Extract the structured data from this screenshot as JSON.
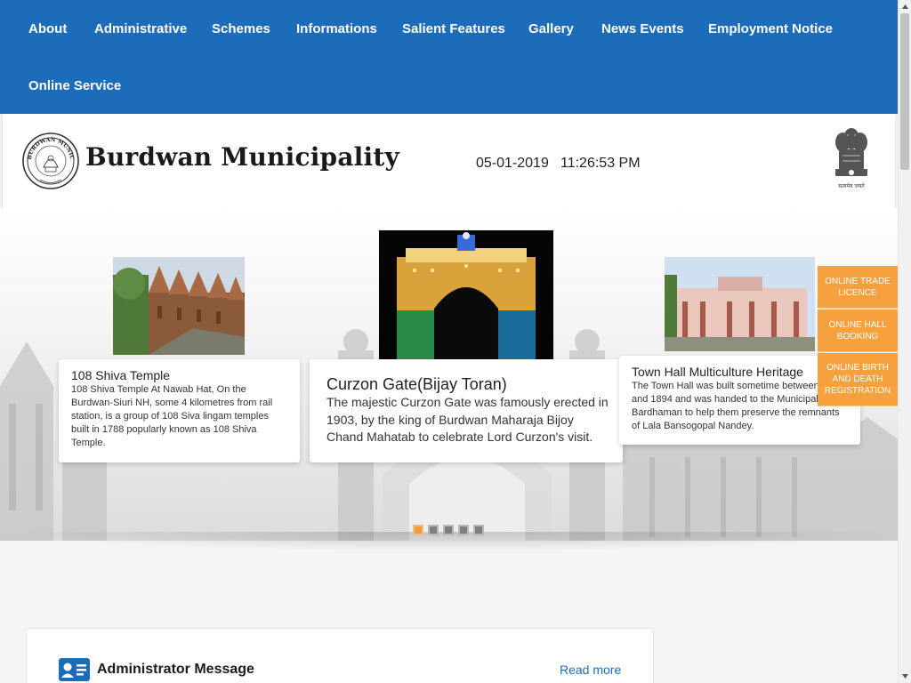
{
  "nav": {
    "items": [
      "About",
      "Administrative",
      "Schemes",
      "Informations",
      "Salient Features",
      "Gallery",
      "News Events",
      "Employment Notice",
      "Online Service"
    ]
  },
  "header": {
    "title": "Burdwan Municipality",
    "date": "05-01-2019",
    "time": "11:26:53 PM",
    "seal_text": "BURDWAN MUNICIPALITY",
    "emblem_text": "सत्यमेव जयते"
  },
  "carousel": {
    "slides": [
      {
        "title": "108 Shiva Temple",
        "text": "108 Shiva Temple At Nawab Hat, On the Burdwan-Siuri NH, some 4 kilometres from rail station, is a group of 108 Siva lingam temples built in 1788 popularly known as 108 Shiva Temple."
      },
      {
        "title": "Curzon Gate(Bijay Toran)",
        "text": "The majestic Curzon Gate was famously erected in 1903, by the king of Burdwan Maharaja Bijoy Chand Mahatab to celebrate Lord Curzon's visit."
      },
      {
        "title": "Town Hall Multiculture Heritage",
        "text": "The Town Hall was built sometime between 1890 and 1894 and was handed to the Municipality of Bardhaman to help them preserve the remnants of Lala Bansogopal Nandey."
      }
    ],
    "active_index": 0,
    "dot_count": 5
  },
  "side_services": [
    "ONLINE TRADE LICENCE",
    "ONLINE HALL BOOKING",
    "ONLINE BIRTH AND DEATH REGISTRATION"
  ],
  "admin": {
    "title": "Administrator Message",
    "read_more": "Read more"
  },
  "colors": {
    "nav_bg": "#1d6cb9",
    "accent_orange": "#f6a13d",
    "link_blue": "#1d6cb9"
  }
}
